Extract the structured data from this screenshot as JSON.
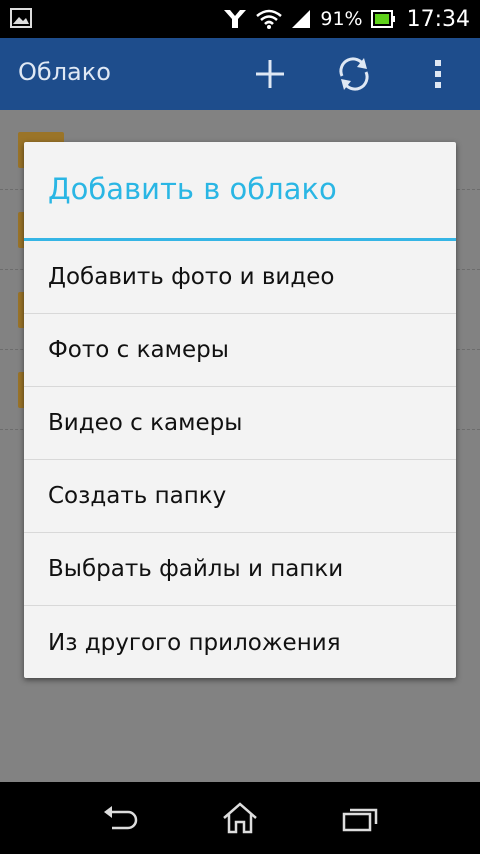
{
  "status_bar": {
    "battery_percent": "91%",
    "time": "17:34",
    "icons": [
      "gallery-icon",
      "usb-debug-icon",
      "wifi-icon",
      "signal-icon",
      "battery-charging-icon"
    ]
  },
  "app_bar": {
    "title": "Облако",
    "actions": [
      "add-icon",
      "refresh-icon",
      "overflow-menu-icon"
    ]
  },
  "dialog": {
    "title": "Добавить в облако",
    "accent_color": "#35b5e5",
    "items": [
      "Добавить фото и видео",
      "Фото с камеры",
      "Видео с камеры",
      "Создать папку",
      "Выбрать файлы и папки",
      "Из другого приложения"
    ]
  },
  "nav_bar": {
    "buttons": [
      "back-icon",
      "home-icon",
      "recent-apps-icon"
    ]
  }
}
